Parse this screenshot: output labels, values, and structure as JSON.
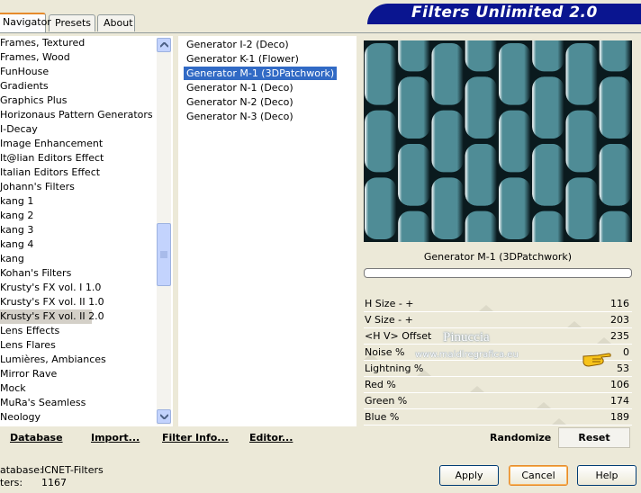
{
  "tabs": [
    {
      "label": "Navigator",
      "active": true
    },
    {
      "label": "Presets",
      "active": false
    },
    {
      "label": "About",
      "active": false
    }
  ],
  "banner_title": "Filters Unlimited 2.0",
  "categories": [
    {
      "label": "Frames, Textured",
      "selected": false
    },
    {
      "label": "Frames, Wood",
      "selected": false
    },
    {
      "label": "FunHouse",
      "selected": false
    },
    {
      "label": "Gradients",
      "selected": false
    },
    {
      "label": "Graphics Plus",
      "selected": false
    },
    {
      "label": "Horizonaus Pattern Generators",
      "selected": false
    },
    {
      "label": "I-Decay",
      "selected": false
    },
    {
      "label": "Image Enhancement",
      "selected": false
    },
    {
      "label": "It@lian Editors Effect",
      "selected": false
    },
    {
      "label": "Italian Editors Effect",
      "selected": false
    },
    {
      "label": "Johann's Filters",
      "selected": false
    },
    {
      "label": "kang 1",
      "selected": false
    },
    {
      "label": "kang 2",
      "selected": false
    },
    {
      "label": "kang 3",
      "selected": false
    },
    {
      "label": "kang 4",
      "selected": false
    },
    {
      "label": "kang",
      "selected": false
    },
    {
      "label": "Kohan's Filters",
      "selected": false
    },
    {
      "label": "Krusty's FX vol. I 1.0",
      "selected": false
    },
    {
      "label": "Krusty's FX vol. II 1.0",
      "selected": false
    },
    {
      "label": "Krusty's FX vol. II 2.0",
      "selected": true
    },
    {
      "label": "Lens Effects",
      "selected": false
    },
    {
      "label": "Lens Flares",
      "selected": false
    },
    {
      "label": "Lumières, Ambiances",
      "selected": false
    },
    {
      "label": "Mirror Rave",
      "selected": false
    },
    {
      "label": "Mock",
      "selected": false
    },
    {
      "label": "MuRa's Seamless",
      "selected": false
    },
    {
      "label": "Neology",
      "selected": false
    }
  ],
  "filters": [
    {
      "label": "Generator I-2 (Deco)",
      "selected": false
    },
    {
      "label": "Generator K-1 (Flower)",
      "selected": false
    },
    {
      "label": "Generator M-1 (3DPatchwork)",
      "selected": true
    },
    {
      "label": "Generator N-1 (Deco)",
      "selected": false
    },
    {
      "label": "Generator N-2 (Deco)",
      "selected": false
    },
    {
      "label": "Generator N-3 (Deco)",
      "selected": false
    }
  ],
  "preview": {
    "caption": "Generator M-1 (3DPatchwork)",
    "colors": {
      "tile": "#4f8c96",
      "dark": "#0a1a1e",
      "light": "#ffffff"
    }
  },
  "controls": [
    {
      "label": "H Size - +",
      "value": "116",
      "level": 0.455
    },
    {
      "label": "V Size - +",
      "value": "203",
      "level": 0.8
    },
    {
      "label": "<H V> Offset",
      "value": "235",
      "level": 0.92
    },
    {
      "label": "Noise %",
      "value": "0",
      "level": 0.0
    },
    {
      "label": "Lightning %",
      "value": "53",
      "level": 0.21
    },
    {
      "label": "Red %",
      "value": "106",
      "level": 0.42
    },
    {
      "label": "Green %",
      "value": "174",
      "level": 0.68
    },
    {
      "label": "Blue %",
      "value": "189",
      "level": 0.74
    }
  ],
  "watermark": {
    "name": "Pinuccia",
    "site": "www.maidiregrafica.eu"
  },
  "actions": {
    "database": "Database",
    "import": "Import...",
    "filter_info": "Filter Info...",
    "editor": "Editor...",
    "randomize": "Randomize",
    "reset": "Reset"
  },
  "status": {
    "database_label": "atabase:",
    "database_value": "ICNET-Filters",
    "filters_label": "ters:",
    "filters_value": "1167"
  },
  "dialog": {
    "apply": "Apply",
    "cancel": "Cancel",
    "help": "Help"
  }
}
